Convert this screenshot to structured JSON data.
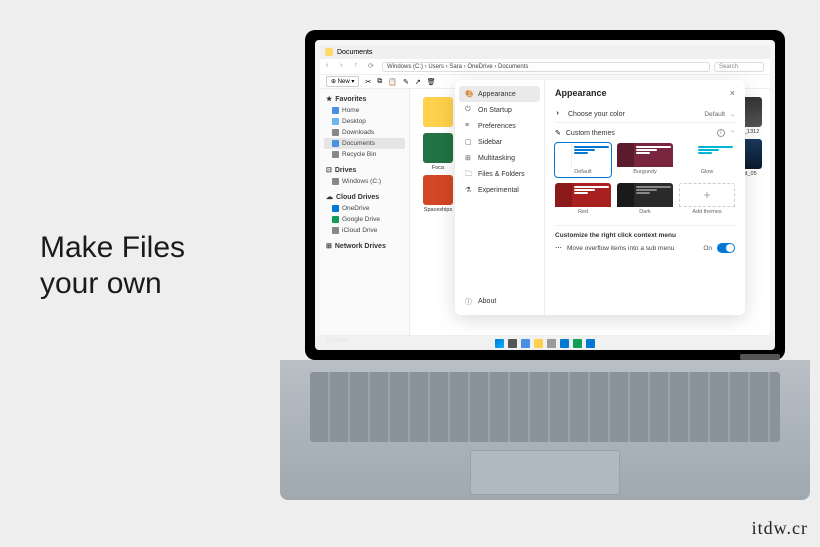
{
  "marketing": {
    "line1": "Make Files",
    "line2": "your own"
  },
  "explorer": {
    "tab_title": "Documents",
    "breadcrumb": "Windows (C:) › Users › Sara › OneDrive › Documents",
    "search_placeholder": "Search",
    "new_button": "New",
    "status": "27 items",
    "sidebar": {
      "favorites": {
        "header": "Favorites",
        "items": [
          "Home",
          "Desktop",
          "Downloads",
          "Documents",
          "Recycle Bin"
        ]
      },
      "drives": {
        "header": "Drives",
        "items": [
          "Windows (C:)"
        ]
      },
      "cloud": {
        "header": "Cloud Drives",
        "items": [
          "OneDrive",
          "Google Drive",
          "iCloud Drive"
        ]
      },
      "network": {
        "header": "Network Drives"
      }
    },
    "files": {
      "folder": "",
      "excel": "Foca",
      "ppt": "Spaceships",
      "img1": "ke_210620_1312",
      "img2": "wfoundland_05"
    }
  },
  "settings": {
    "nav": [
      "Appearance",
      "On Startup",
      "Preferences",
      "Sidebar",
      "Multitasking",
      "Files & Folders",
      "Experimental"
    ],
    "about": "About",
    "title": "Appearance",
    "color_row": {
      "label": "Choose your color",
      "value": "Default"
    },
    "themes": {
      "label": "Custom themes",
      "items": [
        "Default",
        "Burgundy",
        "Glow",
        "Red",
        "Dark"
      ],
      "add": "Add themes"
    },
    "context": {
      "title": "Customize the right click context menu",
      "overflow_label": "Move overflow items into a sub menu",
      "overflow_state": "On"
    }
  },
  "watermark": "itdw.cr"
}
